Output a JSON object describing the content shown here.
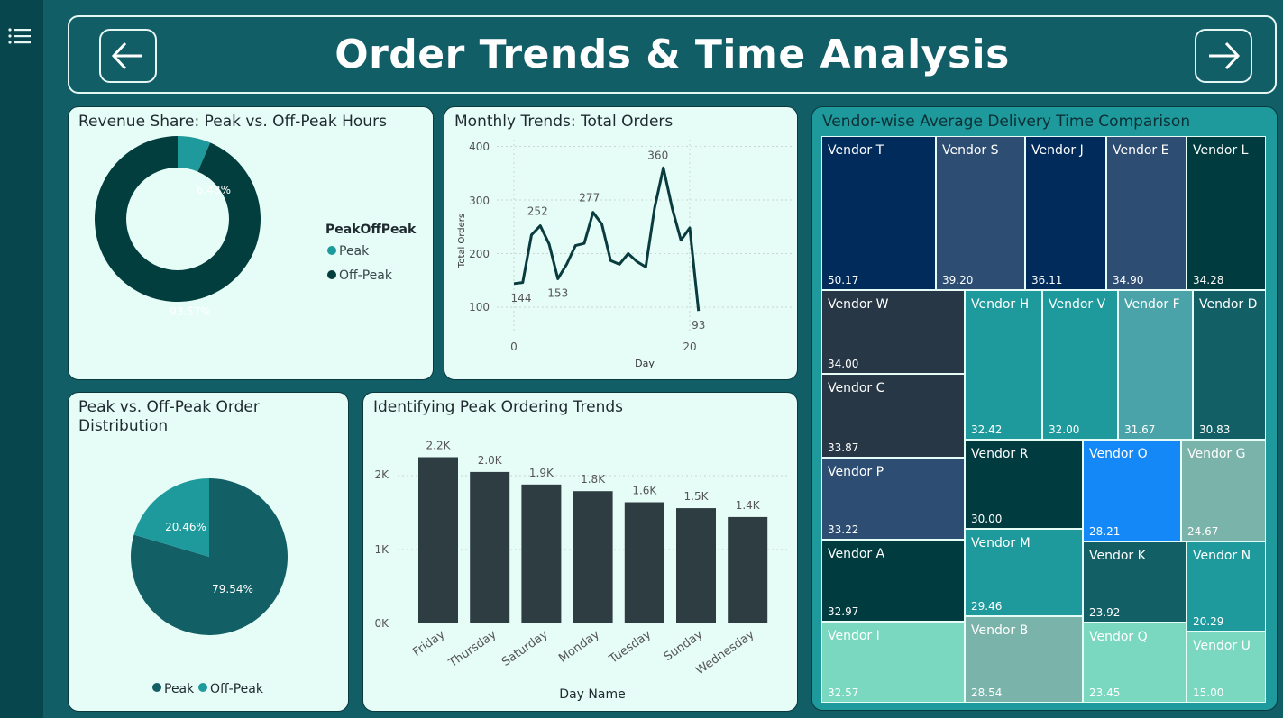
{
  "header": {
    "title": "Order Trends & Time Analysis"
  },
  "donut": {
    "title": "Revenue Share: Peak vs. Off-Peak Hours",
    "legend_title": "PeakOffPeak",
    "legend": [
      {
        "label": "Peak",
        "color": "#1f9a9c"
      },
      {
        "label": "Off-Peak",
        "color": "#033e3f"
      }
    ],
    "slices": [
      {
        "label": "Peak",
        "value": 6.43,
        "text": "6.43%"
      },
      {
        "label": "Off-Peak",
        "value": 93.57,
        "text": "93.57%"
      }
    ]
  },
  "line": {
    "title": "Monthly Trends: Total Orders",
    "ylabel": "Total Orders",
    "xlabel": "Day",
    "yticks": [
      "400",
      "300",
      "200",
      "100"
    ],
    "xticks": [
      "0",
      "20"
    ]
  },
  "pie": {
    "title": "Peak vs. Off-Peak Order Distribution",
    "legend": [
      {
        "label": "Peak",
        "color": "#135f66"
      },
      {
        "label": "Off-Peak",
        "color": "#1f9a9c"
      }
    ],
    "slices": [
      {
        "label": "Peak",
        "value": 79.54,
        "text": "79.54%"
      },
      {
        "label": "Off-Peak",
        "value": 20.46,
        "text": "20.46%"
      }
    ]
  },
  "bar": {
    "title": "Identifying Peak Ordering Trends",
    "xlabel": "Day Name",
    "yticks": [
      "2K",
      "1K",
      "0K"
    ],
    "labels": [
      "2.2K",
      "2.0K",
      "1.9K",
      "1.8K",
      "1.6K",
      "1.5K",
      "1.4K"
    ]
  },
  "treemap": {
    "title": "Vendor-wise Average Delivery Time Comparison",
    "tiles": [
      {
        "name": "Vendor T",
        "value": "50.17",
        "color": "#002b5b"
      },
      {
        "name": "Vendor S",
        "value": "39.20",
        "color": "#2d4d72"
      },
      {
        "name": "Vendor J",
        "value": "36.11",
        "color": "#002b5b"
      },
      {
        "name": "Vendor E",
        "value": "34.90",
        "color": "#2d4d72"
      },
      {
        "name": "Vendor L",
        "value": "34.28",
        "color": "#003b40"
      },
      {
        "name": "Vendor W",
        "value": "34.00",
        "color": "#273745"
      },
      {
        "name": "Vendor C",
        "value": "33.87",
        "color": "#273745"
      },
      {
        "name": "Vendor H",
        "value": "32.42",
        "color": "#1f9a9c"
      },
      {
        "name": "Vendor V",
        "value": "32.00",
        "color": "#1f9a9c"
      },
      {
        "name": "Vendor F",
        "value": "31.67",
        "color": "#4aa3a8"
      },
      {
        "name": "Vendor D",
        "value": "30.83",
        "color": "#135f66"
      },
      {
        "name": "Vendor P",
        "value": "33.22",
        "color": "#2d4d72"
      },
      {
        "name": "Vendor R",
        "value": "30.00",
        "color": "#003b40"
      },
      {
        "name": "Vendor O",
        "value": "28.21",
        "color": "#1488f7"
      },
      {
        "name": "Vendor G",
        "value": "24.67",
        "color": "#7ab3a9"
      },
      {
        "name": "Vendor A",
        "value": "32.97",
        "color": "#003b40"
      },
      {
        "name": "Vendor M",
        "value": "29.46",
        "color": "#1f9a9c"
      },
      {
        "name": "Vendor K",
        "value": "23.92",
        "color": "#135f66"
      },
      {
        "name": "Vendor N",
        "value": "20.29",
        "color": "#1f9a9c"
      },
      {
        "name": "Vendor I",
        "value": "32.57",
        "color": "#79d8bf"
      },
      {
        "name": "Vendor B",
        "value": "28.54",
        "color": "#7ab3a9"
      },
      {
        "name": "Vendor Q",
        "value": "23.45",
        "color": "#79d8bf"
      },
      {
        "name": "Vendor U",
        "value": "15.00",
        "color": "#79d8bf"
      }
    ]
  },
  "chart_data": [
    {
      "type": "pie",
      "title": "Revenue Share: Peak vs. Off-Peak Hours",
      "categories": [
        "Peak",
        "Off-Peak"
      ],
      "values": [
        6.43,
        93.57
      ],
      "legend_title": "PeakOffPeak",
      "legend": "right"
    },
    {
      "type": "line",
      "title": "Monthly Trends: Total Orders",
      "xlabel": "Day",
      "ylabel": "Total Orders",
      "x": [
        0,
        1,
        2,
        3,
        4,
        5,
        6,
        7,
        8,
        9,
        10,
        11,
        12,
        13,
        14,
        15,
        16,
        17,
        18,
        19,
        20,
        21,
        22
      ],
      "y": [
        144,
        146,
        235,
        252,
        218,
        153,
        180,
        215,
        219,
        277,
        255,
        187,
        180,
        200,
        185,
        175,
        285,
        360,
        285,
        225,
        248,
        93
      ],
      "data_labels": {
        "144": 0,
        "252": 3,
        "153": 5,
        "277": 9,
        "360": 17,
        "93": 21
      },
      "xlim": [
        0,
        22
      ],
      "ylim": [
        80,
        410
      ],
      "grid": true
    },
    {
      "type": "pie",
      "title": "Peak vs. Off-Peak Order Distribution",
      "categories": [
        "Peak",
        "Off-Peak"
      ],
      "values": [
        79.54,
        20.46
      ],
      "legend": "bottom"
    },
    {
      "type": "bar",
      "title": "Identifying Peak Ordering Trends",
      "xlabel": "Day Name",
      "categories": [
        "Friday",
        "Thursday",
        "Saturday",
        "Monday",
        "Tuesday",
        "Sunday",
        "Wednesday"
      ],
      "values": [
        2250,
        2050,
        1880,
        1790,
        1640,
        1560,
        1440
      ],
      "ylim": [
        0,
        2400
      ],
      "grid": true
    }
  ]
}
